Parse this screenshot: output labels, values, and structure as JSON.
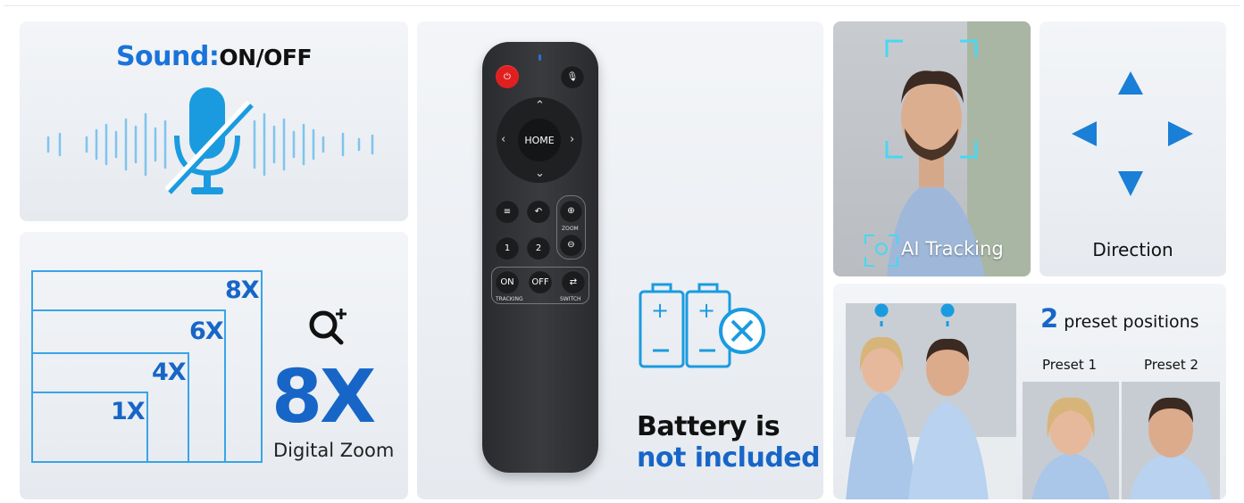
{
  "sound": {
    "title_accent": "Sound:",
    "title_rest": "ON/OFF"
  },
  "zoom": {
    "levels": [
      "8X",
      "6X",
      "4X",
      "1X"
    ],
    "big_value": "8X",
    "subtitle": "Digital Zoom"
  },
  "remote": {
    "home_label": "HOME",
    "zoom_label": "ZOOM",
    "preset_buttons": [
      "1",
      "2"
    ],
    "tracking_on": "ON",
    "tracking_off": "OFF",
    "tracking_label": "TRACKING",
    "switch_label": "SWITCH",
    "power_color": "#e02020"
  },
  "battery": {
    "line1": "Battery is",
    "line2": "not included"
  },
  "ai": {
    "label": "AI Tracking"
  },
  "direction": {
    "label": "Direction"
  },
  "preset": {
    "count": "2",
    "title": "preset positions",
    "labels": [
      "Preset 1",
      "Preset 2"
    ]
  },
  "colors": {
    "accent": "#1766c7",
    "icon_blue": "#1a9be0"
  }
}
